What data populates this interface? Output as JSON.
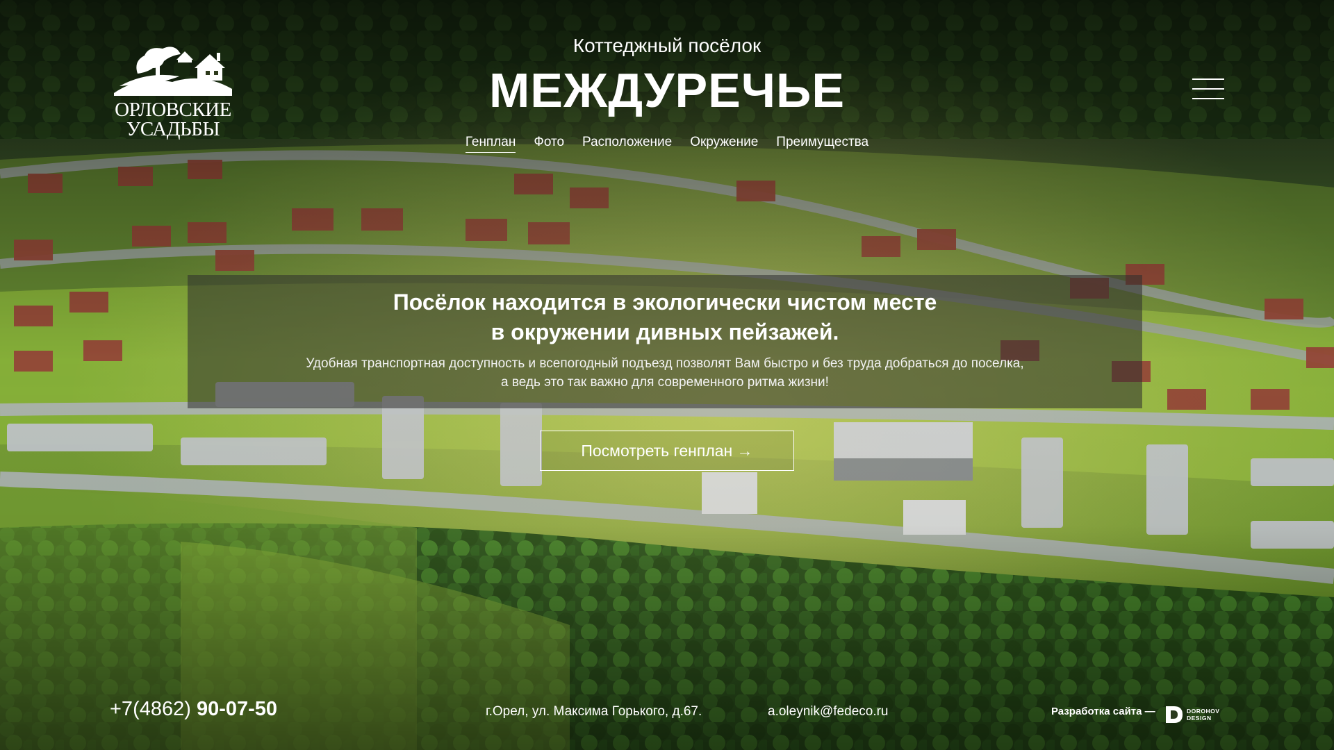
{
  "brand": {
    "logo_line1": "ОРЛОВСКИЕ",
    "logo_line2": "УСАДЬБЫ"
  },
  "header": {
    "subtitle": "Коттеджный посёлок",
    "title": "МЕЖДУРЕЧЬЕ",
    "menu_icon": "hamburger-menu-icon"
  },
  "nav": {
    "items": [
      {
        "label": "Генплан",
        "active": true
      },
      {
        "label": "Фото"
      },
      {
        "label": "Расположение"
      },
      {
        "label": "Окружение"
      },
      {
        "label": "Преимущества"
      }
    ]
  },
  "hero": {
    "headline_line1": "Посёлок находится в экологически чистом месте",
    "headline_line2": "в окружении дивных пейзажей.",
    "lead_line1": "Удобная транспортная доступность и всепогодный подъезд позволят Вам быстро и без труда добраться до поселка,",
    "lead_line2": "а ведь это так важно для  современного ритма жизни!",
    "cta_label": "Посмотреть генплан →"
  },
  "footer": {
    "phone_prefix": "+7(4862) ",
    "phone_number": "90-07-50",
    "address": "г.Орел, ул. Максима Горького, д.67.",
    "email": "a.oleynik@fedeco.ru",
    "developer_label": "Разработка сайта —",
    "developer_logo_line1": "DOROHOV",
    "developer_logo_line2": "DESIGN"
  },
  "colors": {
    "text": "#ffffff",
    "panel_bg": "#2d2d2d",
    "grass": "#8fb83a",
    "forest": "#2f5a1e",
    "roof_red": "#a04a3a",
    "road": "#9aa3a8"
  }
}
